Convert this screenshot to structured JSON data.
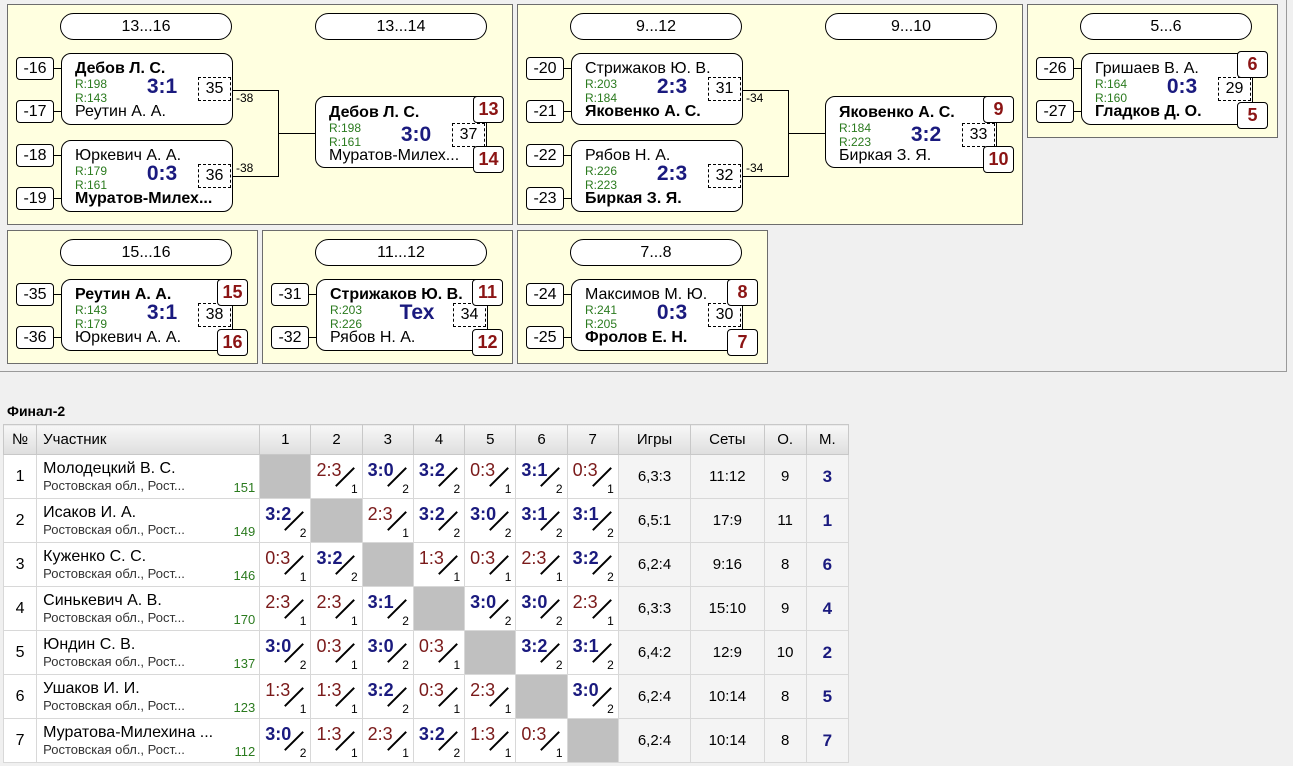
{
  "brackets": {
    "p13_16": {
      "header1": "13...16",
      "header2": "13...14",
      "m35": {
        "seedA": "-16",
        "seedB": "-17",
        "a": "Дебов Л. С.",
        "b": "Реутин А. А.",
        "ra": "R:198",
        "rb": "R:143",
        "score": "3:1",
        "no": "35",
        "lose": "-38"
      },
      "m36": {
        "seedA": "-18",
        "seedB": "-19",
        "a": "Юркевич А. А.",
        "b": "Муратов-Милех...",
        "ra": "R:179",
        "rb": "R:161",
        "score": "0:3",
        "no": "36",
        "lose": "-38"
      },
      "m37": {
        "a": "Дебов Л. С.",
        "b": "Муратов-Милех...",
        "ra": "R:198",
        "rb": "R:161",
        "score": "3:0",
        "no": "37",
        "pa": "13",
        "pb": "14"
      }
    },
    "p9_12": {
      "header1": "9...12",
      "header2": "9...10",
      "m31": {
        "seedA": "-20",
        "seedB": "-21",
        "a": "Стрижаков Ю. В.",
        "b": "Яковенко А. С.",
        "ra": "R:203",
        "rb": "R:184",
        "score": "2:3",
        "no": "31",
        "lose": "-34"
      },
      "m32": {
        "seedA": "-22",
        "seedB": "-23",
        "a": "Рябов Н. А.",
        "b": "Биркая З. Я.",
        "ra": "R:226",
        "rb": "R:223",
        "score": "2:3",
        "no": "32",
        "lose": "-34"
      },
      "m33": {
        "a": "Яковенко А. С.",
        "b": "Биркая З. Я.",
        "ra": "R:184",
        "rb": "R:223",
        "score": "3:2",
        "no": "33",
        "pa": "9",
        "pb": "10"
      }
    },
    "p5_6": {
      "header": "5...6",
      "m29": {
        "seedA": "-26",
        "seedB": "-27",
        "a": "Гришаев В. А.",
        "b": "Гладков Д. О.",
        "ra": "R:164",
        "rb": "R:160",
        "score": "0:3",
        "no": "29",
        "pa": "6",
        "pb": "5"
      }
    },
    "p15_16": {
      "header": "15...16",
      "m38": {
        "seedA": "-35",
        "seedB": "-36",
        "a": "Реутин А. А.",
        "b": "Юркевич А. А.",
        "ra": "R:143",
        "rb": "R:179",
        "score": "3:1",
        "no": "38",
        "pa": "15",
        "pb": "16"
      }
    },
    "p11_12": {
      "header": "11...12",
      "m34": {
        "seedA": "-31",
        "seedB": "-32",
        "a": "Стрижаков Ю. В.",
        "b": "Рябов Н. А.",
        "ra": "R:203",
        "rb": "R:226",
        "score": "Тех",
        "no": "34",
        "pa": "11",
        "pb": "12"
      }
    },
    "p7_8": {
      "header": "7...8",
      "m30": {
        "seedA": "-24",
        "seedB": "-25",
        "a": "Максимов М. Ю.",
        "b": "Фролов Е. Н.",
        "ra": "R:241",
        "rb": "R:205",
        "score": "0:3",
        "no": "30",
        "pa": "8",
        "pb": "7"
      }
    }
  },
  "final": {
    "title": "Финал-2",
    "headers": [
      "№",
      "Участник",
      "1",
      "2",
      "3",
      "4",
      "5",
      "6",
      "7",
      "Игры",
      "Сеты",
      "О.",
      "М."
    ],
    "rows": [
      {
        "n": "1",
        "name": "Молодецкий В. С.",
        "city": "Ростовская обл., Рост...",
        "rating": "151",
        "games": "6,3:3",
        "sets": "11:12",
        "points": "9",
        "place": "3",
        "cells": [
          null,
          [
            "2:3",
            "1",
            false
          ],
          [
            "3:0",
            "2",
            true
          ],
          [
            "3:2",
            "2",
            true
          ],
          [
            "0:3",
            "1",
            false
          ],
          [
            "3:1",
            "2",
            true
          ],
          [
            "0:3",
            "1",
            false
          ]
        ]
      },
      {
        "n": "2",
        "name": "Исаков И. А.",
        "city": "Ростовская обл., Рост...",
        "rating": "149",
        "games": "6,5:1",
        "sets": "17:9",
        "points": "11",
        "place": "1",
        "cells": [
          [
            "3:2",
            "2",
            true
          ],
          null,
          [
            "2:3",
            "1",
            false
          ],
          [
            "3:2",
            "2",
            true
          ],
          [
            "3:0",
            "2",
            true
          ],
          [
            "3:1",
            "2",
            true
          ],
          [
            "3:1",
            "2",
            true
          ]
        ]
      },
      {
        "n": "3",
        "name": "Куженко С. С.",
        "city": "Ростовская обл., Рост...",
        "rating": "146",
        "games": "6,2:4",
        "sets": "9:16",
        "points": "8",
        "place": "6",
        "cells": [
          [
            "0:3",
            "1",
            false
          ],
          [
            "3:2",
            "2",
            true
          ],
          null,
          [
            "1:3",
            "1",
            false
          ],
          [
            "0:3",
            "1",
            false
          ],
          [
            "2:3",
            "1",
            false
          ],
          [
            "3:2",
            "2",
            true
          ]
        ]
      },
      {
        "n": "4",
        "name": "Синькевич А. В.",
        "city": "Ростовская обл., Рост...",
        "rating": "170",
        "games": "6,3:3",
        "sets": "15:10",
        "points": "9",
        "place": "4",
        "cells": [
          [
            "2:3",
            "1",
            false
          ],
          [
            "2:3",
            "1",
            false
          ],
          [
            "3:1",
            "2",
            true
          ],
          null,
          [
            "3:0",
            "2",
            true
          ],
          [
            "3:0",
            "2",
            true
          ],
          [
            "2:3",
            "1",
            false
          ]
        ]
      },
      {
        "n": "5",
        "name": "Юндин С. В.",
        "city": "Ростовская обл., Рост...",
        "rating": "137",
        "games": "6,4:2",
        "sets": "12:9",
        "points": "10",
        "place": "2",
        "cells": [
          [
            "3:0",
            "2",
            true
          ],
          [
            "0:3",
            "1",
            false
          ],
          [
            "3:0",
            "2",
            true
          ],
          [
            "0:3",
            "1",
            false
          ],
          null,
          [
            "3:2",
            "2",
            true
          ],
          [
            "3:1",
            "2",
            true
          ]
        ]
      },
      {
        "n": "6",
        "name": "Ушаков И. И.",
        "city": "Ростовская обл., Рост...",
        "rating": "123",
        "games": "6,2:4",
        "sets": "10:14",
        "points": "8",
        "place": "5",
        "cells": [
          [
            "1:3",
            "1",
            false
          ],
          [
            "1:3",
            "1",
            false
          ],
          [
            "3:2",
            "2",
            true
          ],
          [
            "0:3",
            "1",
            false
          ],
          [
            "2:3",
            "1",
            false
          ],
          null,
          [
            "3:0",
            "2",
            true
          ]
        ]
      },
      {
        "n": "7",
        "name": "Муратова-Милехина ...",
        "city": "Ростовская обл., Рост...",
        "rating": "112",
        "games": "6,2:4",
        "sets": "10:14",
        "points": "8",
        "place": "7",
        "cells": [
          [
            "3:0",
            "2",
            true
          ],
          [
            "1:3",
            "1",
            false
          ],
          [
            "2:3",
            "1",
            false
          ],
          [
            "3:2",
            "2",
            true
          ],
          [
            "1:3",
            "1",
            false
          ],
          [
            "0:3",
            "1",
            false
          ],
          null
        ]
      }
    ]
  }
}
